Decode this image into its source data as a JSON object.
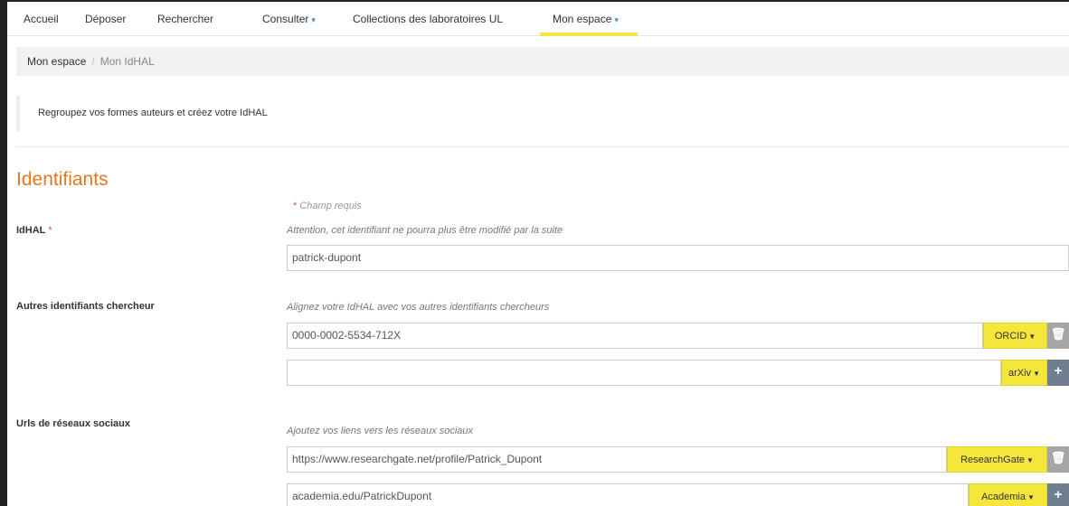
{
  "nav": {
    "items": [
      {
        "label": "Accueil",
        "dropdown": false
      },
      {
        "label": "Déposer",
        "dropdown": false
      },
      {
        "label": "Rechercher",
        "dropdown": false
      },
      {
        "label": "Consulter",
        "dropdown": true
      },
      {
        "label": "Collections des laboratoires UL",
        "dropdown": false
      }
    ],
    "active": {
      "label": "Mon espace",
      "dropdown": true
    },
    "caret": "▾",
    "active_underline_color": "#f5e63b"
  },
  "breadcrumb": {
    "parent": "Mon espace",
    "separator": "/",
    "current": "Mon IdHAL"
  },
  "notice": "Regroupez vos formes auteurs et créez votre IdHAL",
  "section_title": "Identifiants",
  "required_note": {
    "star": "*",
    "text": "Champ requis"
  },
  "idhal": {
    "label": "IdHAL",
    "star": "*",
    "help": "Attention, cet identifiant ne pourra plus être modifié par la suite",
    "value": "patrick-dupont"
  },
  "researcher_ids": {
    "label": "Autres identifiants chercheur",
    "help": "Alignez votre IdHAL avec vos autres identifiants chercheurs",
    "rows": [
      {
        "value": "0000-0002-5534-712X",
        "type": "ORCID",
        "action": "delete",
        "action_icon": "trash-icon"
      },
      {
        "value": "",
        "type": "arXiv",
        "action": "add",
        "action_icon": "plus-icon"
      }
    ]
  },
  "social": {
    "label": "Urls de réseaux sociaux",
    "help": "Ajoutez vos liens vers les réseaux sociaux",
    "rows": [
      {
        "value": "https://www.researchgate.net/profile/Patrick_Dupont",
        "type": "ResearchGate",
        "action": "delete",
        "action_icon": "trash-icon"
      },
      {
        "value": "academia.edu/PatrickDupont",
        "type": "Academia",
        "action": "add",
        "action_icon": "plus-icon"
      }
    ]
  },
  "colors": {
    "accent_title": "#e07820",
    "addon_yellow": "#f5e63b",
    "required_red": "#d9534f"
  }
}
